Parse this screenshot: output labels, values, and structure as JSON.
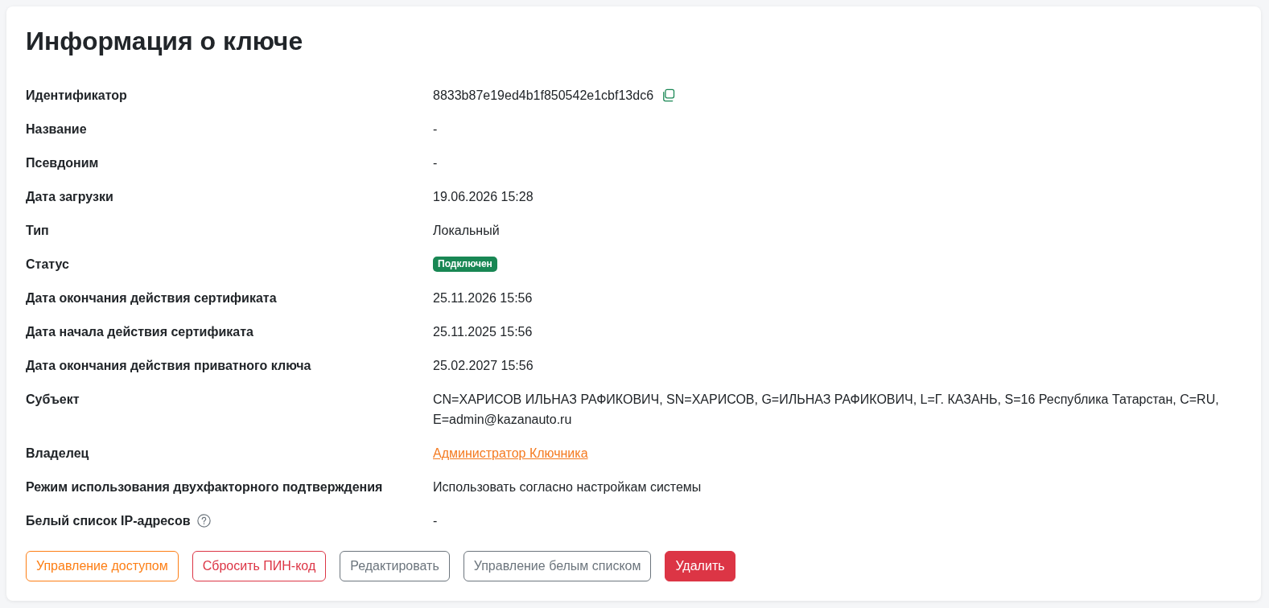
{
  "title": "Информация о ключе",
  "fields": [
    {
      "label": "Идентификатор",
      "kind": "copyable",
      "value": "8833b87e19ed4b1f850542e1cbf13dc6",
      "help_icon": false
    },
    {
      "label": "Название",
      "kind": "text",
      "value": "-",
      "help_icon": false
    },
    {
      "label": "Псевдоним",
      "kind": "text",
      "value": "-",
      "help_icon": false
    },
    {
      "label": "Дата загрузки",
      "kind": "text",
      "value": "19.06.2026 15:28",
      "help_icon": false
    },
    {
      "label": "Тип",
      "kind": "text",
      "value": "Локальный",
      "help_icon": false
    },
    {
      "label": "Статус",
      "kind": "badge",
      "value": "Подключен",
      "color": "#198754",
      "help_icon": false
    },
    {
      "label": "Дата окончания действия сертификата",
      "kind": "text",
      "value": "25.11.2026 15:56",
      "help_icon": false
    },
    {
      "label": "Дата начала действия сертификата",
      "kind": "text",
      "value": "25.11.2025 15:56",
      "help_icon": false
    },
    {
      "label": "Дата окончания действия приватного ключа",
      "kind": "text",
      "value": "25.02.2027 15:56",
      "help_icon": false
    },
    {
      "label": "Субъект",
      "kind": "text",
      "value": "CN=ХАРИСОВ ИЛЬНАЗ РАФИКОВИЧ, SN=ХАРИСОВ, G=ИЛЬНАЗ РАФИКОВИЧ, L=Г. КАЗАНЬ, S=16 Республика Татарстан, C=RU, E=admin@kazanauto.ru",
      "help_icon": false
    },
    {
      "label": "Владелец",
      "kind": "link",
      "value": "Администратор Ключника",
      "help_icon": false
    },
    {
      "label": "Режим использования двухфакторного подтверждения",
      "kind": "text",
      "value": "Использовать согласно настройкам системы",
      "help_icon": false
    },
    {
      "label": "Белый список IP-адресов",
      "kind": "text",
      "value": "-",
      "help_icon": true
    }
  ],
  "buttons": [
    {
      "label": "Управление доступом",
      "kind": "outline-orange"
    },
    {
      "label": "Сбросить ПИН-код",
      "kind": "outline-danger"
    },
    {
      "label": "Редактировать",
      "kind": "outline-secondary"
    },
    {
      "label": "Управление белым списком",
      "kind": "outline-secondary"
    },
    {
      "label": "Удалить",
      "kind": "danger"
    }
  ]
}
